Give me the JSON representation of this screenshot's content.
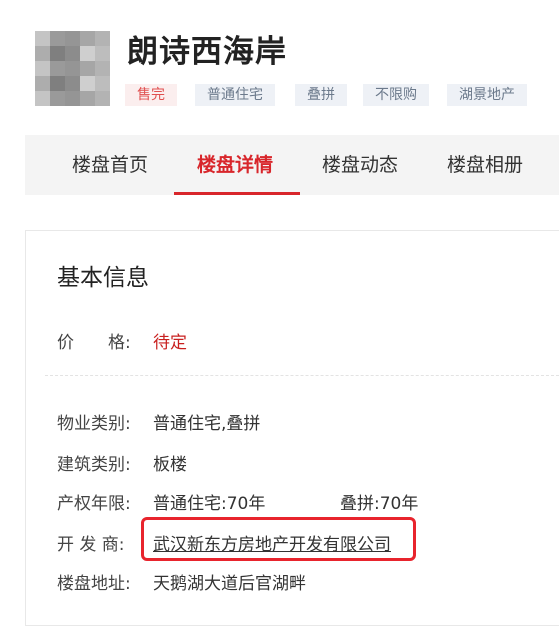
{
  "header": {
    "title": "朗诗西海岸",
    "tags": [
      "售完",
      "普通住宅",
      "叠拼",
      "不限购",
      "湖景地产"
    ]
  },
  "nav": {
    "items": [
      "楼盘首页",
      "楼盘详情",
      "楼盘动态",
      "楼盘相册"
    ],
    "active": "楼盘详情"
  },
  "basic_info": {
    "section_title": "基本信息",
    "price": {
      "label": "价　　格:",
      "value": "待定"
    },
    "property_type": {
      "label": "物业类别:",
      "value": "普通住宅,叠拼"
    },
    "building_type": {
      "label": "建筑类别:",
      "value": "板楼"
    },
    "tenure": {
      "label": "产权年限:",
      "value_1": "普通住宅:70年",
      "value_2": "叠拼:70年"
    },
    "developer": {
      "label": "开 发 商:",
      "value": "武汉新东方房地产开发有限公司"
    },
    "address": {
      "label": "楼盘地址:",
      "value": "天鹅湖大道后官湖畔"
    }
  },
  "colors": {
    "accent": "#d8262b",
    "highlight_border": "#e8242d",
    "tag_bg": "#eef1f6",
    "sold_tag_bg": "#fbeeee"
  }
}
